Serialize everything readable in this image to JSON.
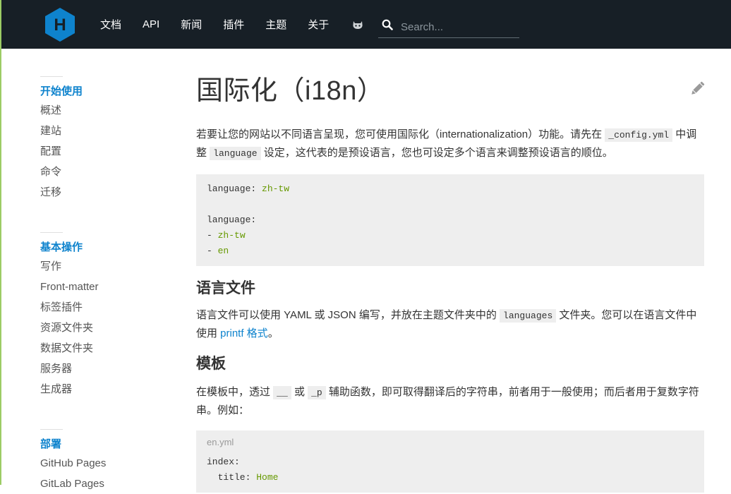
{
  "header": {
    "logo_letter": "H",
    "nav": [
      "文档",
      "API",
      "新闻",
      "插件",
      "主题",
      "关于"
    ],
    "search_placeholder": "Search..."
  },
  "sidebar": {
    "sections": [
      {
        "title": "开始使用",
        "items": [
          "概述",
          "建站",
          "配置",
          "命令",
          "迁移"
        ]
      },
      {
        "title": "基本操作",
        "items": [
          "写作",
          "Front-matter",
          "标签插件",
          "资源文件夹",
          "数据文件夹",
          "服务器",
          "生成器"
        ]
      },
      {
        "title": "部署",
        "items": [
          "GitHub Pages",
          "GitLab Pages"
        ]
      }
    ]
  },
  "main": {
    "title": "国际化（i18n）",
    "intro": {
      "t1": "若要让您的网站以不同语言呈现，您可使用国际化（internationalization）功能。请先在 ",
      "c1": "_config.yml",
      "t2": " 中调整 ",
      "c2": "language",
      "t3": " 设定，这代表的是预设语言，您也可设定多个语言来调整预设语言的顺位。"
    },
    "code1": {
      "l1_key": "language: ",
      "l1_val": "zh-tw",
      "l3": "language:",
      "l4_dash": "- ",
      "l4_val": "zh-tw",
      "l5_dash": "- ",
      "l5_val": "en"
    },
    "h_lang": "语言文件",
    "lang_p": {
      "t1": "语言文件可以使用 YAML 或 JSON 编写，并放在主题文件夹中的 ",
      "c1": "languages",
      "t2": " 文件夹。您可以在语言文件中使用 ",
      "link": "printf 格式",
      "t3": "。"
    },
    "h_tpl": "模板",
    "tpl_p": {
      "t1": "在模板中，透过 ",
      "c1": "__",
      "t2": " 或 ",
      "c2": "_p",
      "t3": " 辅助函数，即可取得翻译后的字符串，前者用于一般使用；而后者用于复数字符串。例如："
    },
    "code2": {
      "filename": "en.yml",
      "l1": "index:",
      "l2_key": "  title: ",
      "l2_val": "Home"
    }
  },
  "colors": {
    "header_bg": "#171f26",
    "accent": "#0e83cd",
    "logo": "#0e83cd",
    "string": "#669900"
  }
}
